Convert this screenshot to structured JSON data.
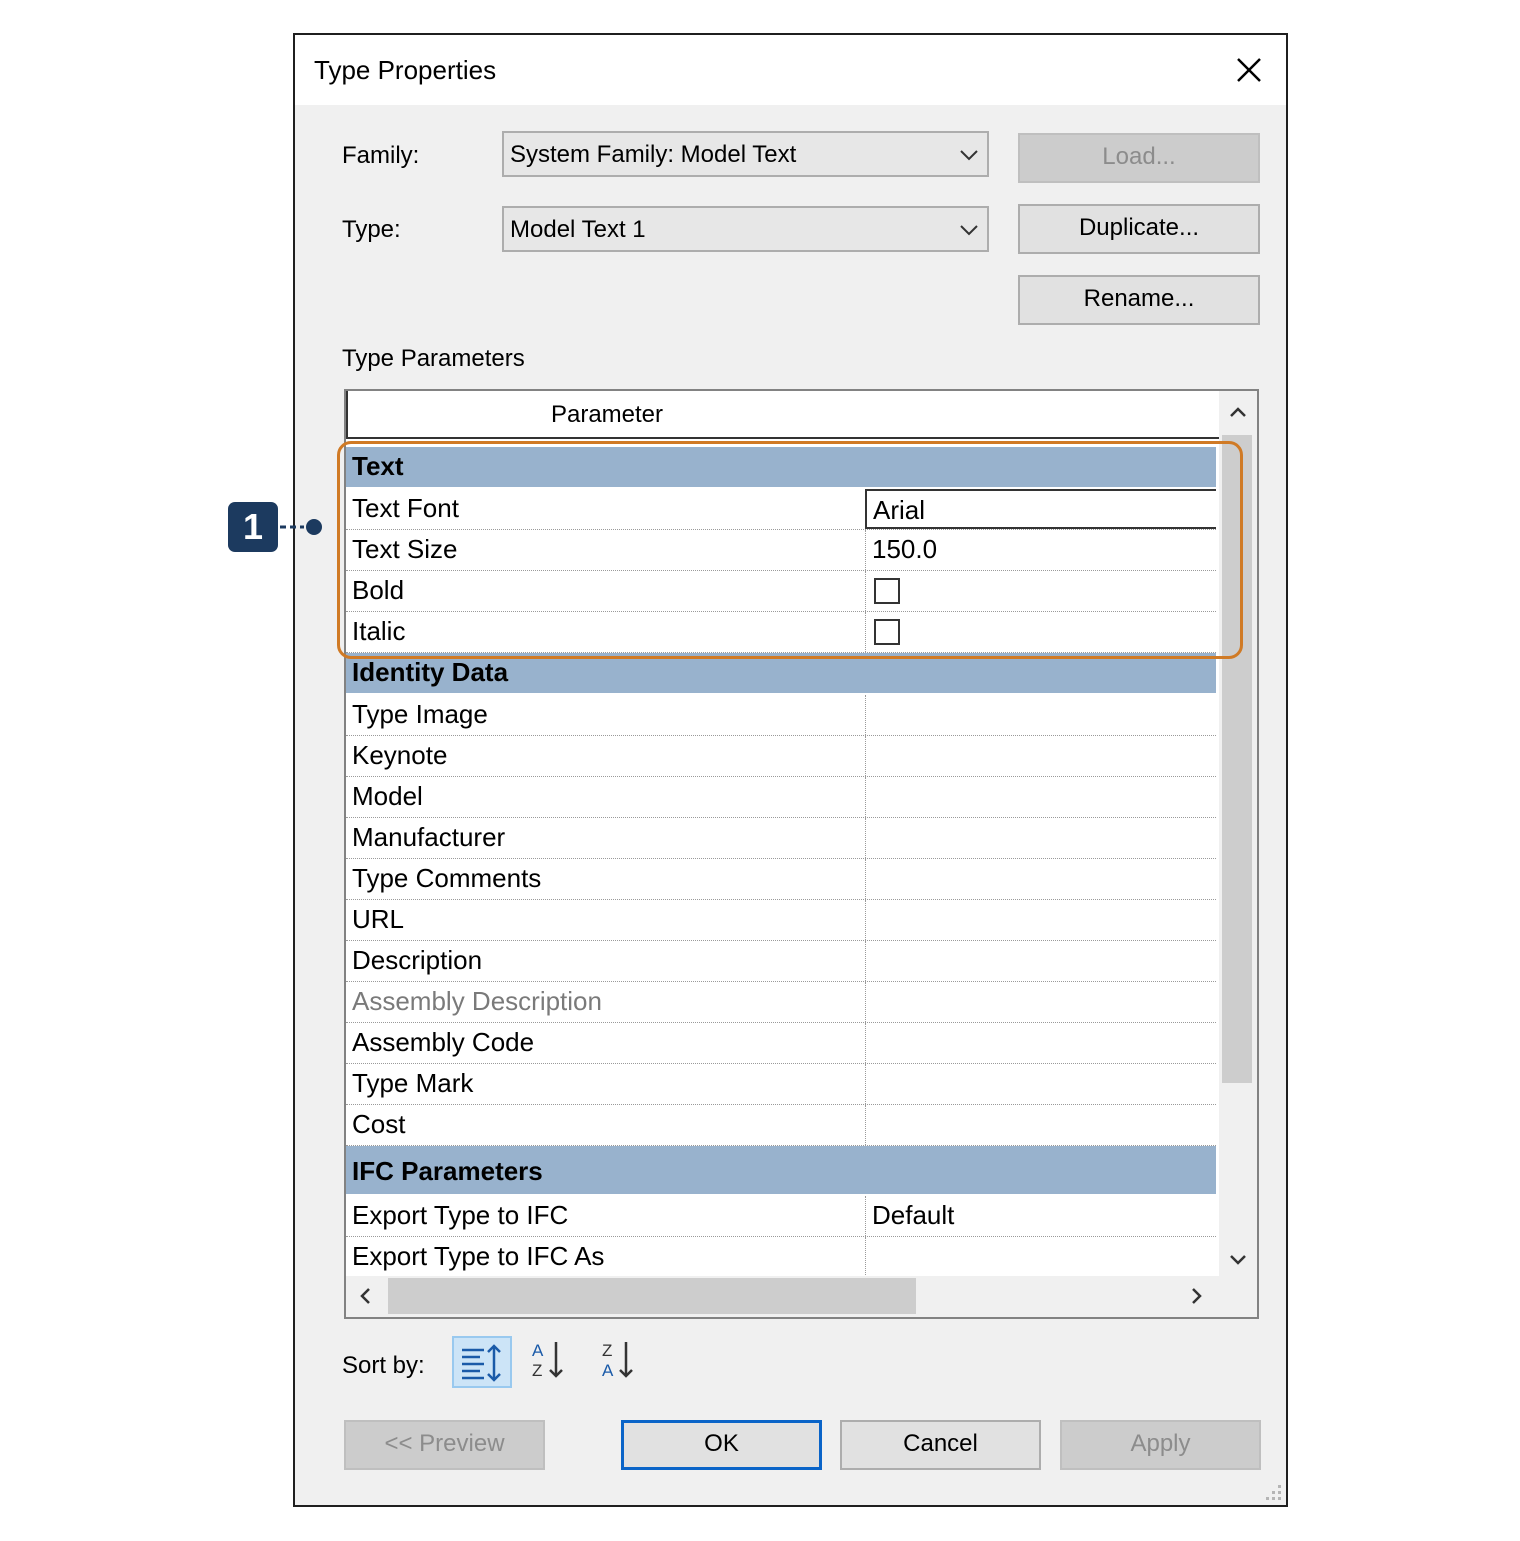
{
  "dialog": {
    "title": "Type Properties"
  },
  "family": {
    "label": "Family:",
    "value": "System Family: Model Text"
  },
  "type": {
    "label": "Type:",
    "value": "Model Text 1"
  },
  "buttons": {
    "load": "Load...",
    "duplicate": "Duplicate...",
    "rename": "Rename...",
    "preview": "<< Preview",
    "ok": "OK",
    "cancel": "Cancel",
    "apply": "Apply"
  },
  "type_parameters": {
    "label": "Type Parameters",
    "column_header": "Parameter",
    "groups": [
      {
        "name": "Text",
        "rows": [
          {
            "name": "Text Font",
            "value": "Arial"
          },
          {
            "name": "Text Size",
            "value": "150.0"
          },
          {
            "name": "Bold",
            "checked": false
          },
          {
            "name": "Italic",
            "checked": false
          }
        ]
      },
      {
        "name": "Identity Data",
        "rows": [
          {
            "name": "Type Image",
            "value": ""
          },
          {
            "name": "Keynote",
            "value": ""
          },
          {
            "name": "Model",
            "value": ""
          },
          {
            "name": "Manufacturer",
            "value": ""
          },
          {
            "name": "Type Comments",
            "value": ""
          },
          {
            "name": "URL",
            "value": ""
          },
          {
            "name": "Description",
            "value": ""
          },
          {
            "name": "Assembly Description",
            "value": "",
            "disabled": true
          },
          {
            "name": "Assembly Code",
            "value": ""
          },
          {
            "name": "Type Mark",
            "value": ""
          },
          {
            "name": "Cost",
            "value": ""
          }
        ]
      },
      {
        "name": "IFC Parameters",
        "rows": [
          {
            "name": "Export Type to IFC",
            "value": "Default"
          },
          {
            "name": "Export Type to IFC As",
            "value": ""
          }
        ]
      }
    ]
  },
  "sort": {
    "label": "Sort by:",
    "options": [
      "grouped",
      "ascending",
      "descending"
    ],
    "active": "grouped"
  },
  "callout": {
    "number": "1",
    "color": "#1c3a5f",
    "highlight_color": "#d07a25"
  },
  "colors": {
    "group_header": "#98b2cd",
    "ok_border": "#0a64c8",
    "sort_active": "#cce4f7"
  }
}
